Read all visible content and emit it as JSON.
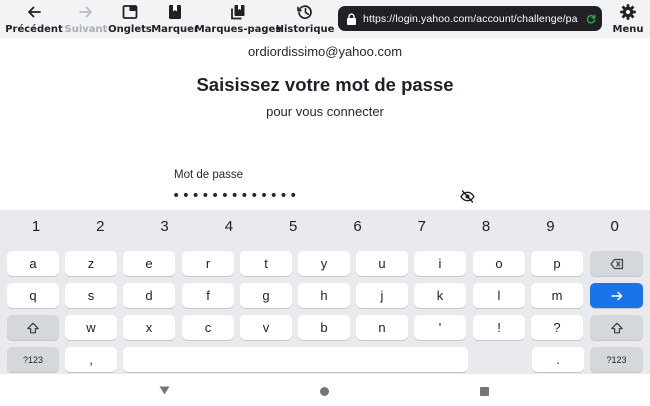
{
  "toolbar": {
    "previous_label": "Précédent",
    "next_label": "Suivant",
    "tabs_label": "Onglets",
    "mark_label": "Marquer",
    "bookmarks_label": "Marques-pages",
    "history_label": "Historique",
    "menu_label": "Menu",
    "url": "https://login.yahoo.com/account/challenge/pa"
  },
  "page": {
    "account_email": "ordiordissimo@yahoo.com",
    "heading": "Saisissez votre mot de passe",
    "subheading": "pour vous connecter",
    "password_label": "Mot de passe",
    "password_value": "•••••••••••••"
  },
  "keyboard": {
    "numbers": [
      "1",
      "2",
      "3",
      "4",
      "5",
      "6",
      "7",
      "8",
      "9",
      "0"
    ],
    "row1": [
      "a",
      "z",
      "e",
      "r",
      "t",
      "y",
      "u",
      "i",
      "o",
      "p"
    ],
    "row2": [
      "q",
      "s",
      "d",
      "f",
      "g",
      "h",
      "j",
      "k",
      "l",
      "m"
    ],
    "row3": [
      "w",
      "x",
      "c",
      "v",
      "b",
      "n",
      "'",
      "!",
      "?"
    ],
    "symbols_label": "?123",
    "comma": ",",
    "period": "."
  },
  "colors": {
    "accent": "#1a73e8",
    "url_bar": "#202124",
    "secure_reload": "#34a853"
  }
}
